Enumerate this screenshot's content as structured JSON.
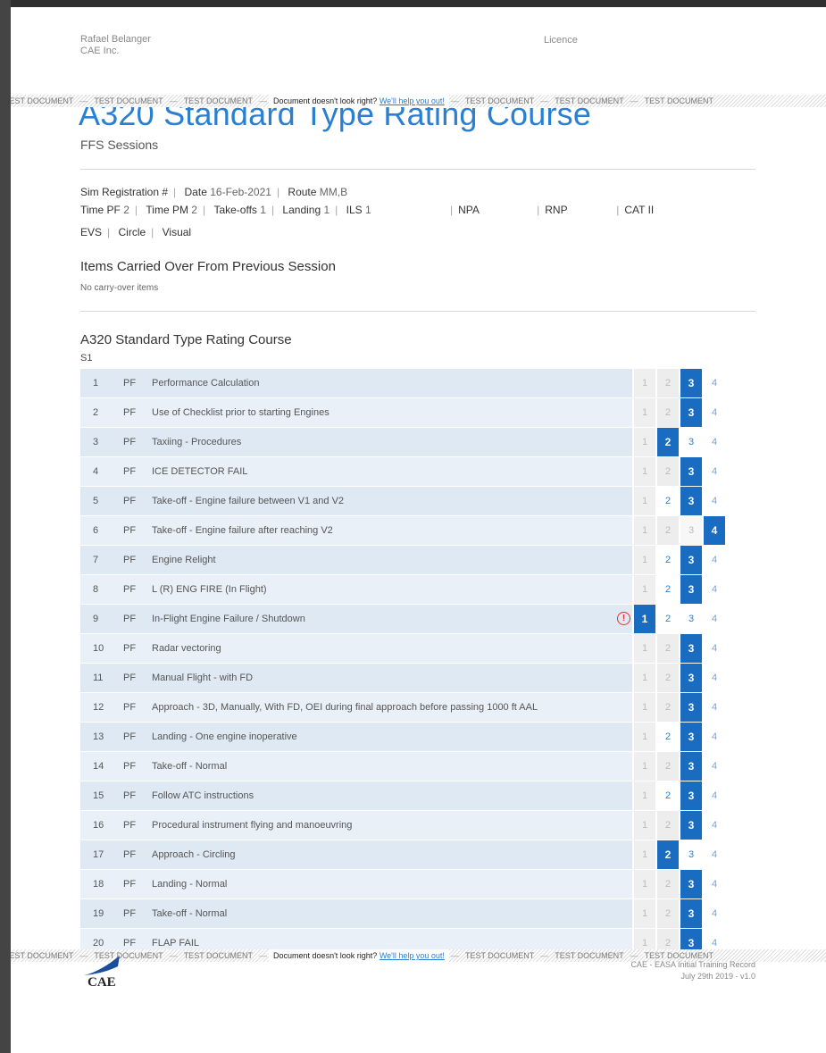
{
  "header": {
    "name": "Rafael Belanger",
    "company": "CAE Inc.",
    "licence_label": "Licence"
  },
  "banner": {
    "tag": "TEST DOCUMENT",
    "message": "Document doesn't look right?",
    "link": "We'll help you out!"
  },
  "title": "A320 Standard Type Rating Course",
  "subtitle": "FFS Sessions",
  "info": {
    "sim_registration_label": "Sim Registration #",
    "date_label": "Date",
    "date_value": "16-Feb-2021",
    "route_label": "Route",
    "route_value": "MM,B",
    "time_pf_label": "Time PF",
    "time_pf_value": "2",
    "time_pm_label": "Time PM",
    "time_pm_value": "2",
    "takeoffs_label": "Take-offs",
    "takeoffs_value": "1",
    "landing_label": "Landing",
    "landing_value": "1",
    "ils_label": "ILS",
    "ils_value": "1",
    "npa_label": "NPA",
    "rnp_label": "RNP",
    "cat2_label": "CAT II",
    "evs_label": "EVS",
    "circle_label": "Circle",
    "visual_label": "Visual"
  },
  "carry_over": {
    "heading": "Items Carried Over From Previous Session",
    "text": "No carry-over items"
  },
  "course": {
    "heading": "A320 Standard Type Rating Course",
    "session": "S1"
  },
  "grade_labels": [
    "1",
    "2",
    "3",
    "4"
  ],
  "items": [
    {
      "num": "1",
      "role": "PF",
      "desc": "Performance Calculation",
      "grade": 3,
      "lit": []
    },
    {
      "num": "2",
      "role": "PF",
      "desc": "Use of Checklist prior to starting Engines",
      "grade": 3,
      "lit": []
    },
    {
      "num": "3",
      "role": "PF",
      "desc": "Taxiing - Procedures",
      "grade": 2,
      "lit": []
    },
    {
      "num": "4",
      "role": "PF",
      "desc": "ICE DETECTOR FAIL",
      "grade": 3,
      "lit": []
    },
    {
      "num": "5",
      "role": "PF",
      "desc": "Take-off - Engine failure between V1 and V2",
      "grade": 3,
      "lit": [
        2
      ]
    },
    {
      "num": "6",
      "role": "PF",
      "desc": "Take-off - Engine failure after reaching V2",
      "grade": 4,
      "lit": []
    },
    {
      "num": "7",
      "role": "PF",
      "desc": "Engine Relight",
      "grade": 3,
      "lit": [
        2
      ]
    },
    {
      "num": "8",
      "role": "PF",
      "desc": "L (R) ENG FIRE (In Flight)",
      "grade": 3,
      "lit": [
        2
      ]
    },
    {
      "num": "9",
      "role": "PF",
      "desc": "In-Flight Engine Failure / Shutdown",
      "grade": 1,
      "lit": [
        2
      ],
      "warning": true
    },
    {
      "num": "10",
      "role": "PF",
      "desc": "Radar vectoring",
      "grade": 3,
      "lit": []
    },
    {
      "num": "11",
      "role": "PF",
      "desc": "Manual Flight - with FD",
      "grade": 3,
      "lit": []
    },
    {
      "num": "12",
      "role": "PF",
      "desc": "Approach - 3D, Manually, With FD, OEI during final approach before passing 1000 ft AAL",
      "grade": 3,
      "lit": []
    },
    {
      "num": "13",
      "role": "PF",
      "desc": "Landing - One engine inoperative",
      "grade": 3,
      "lit": [
        2
      ]
    },
    {
      "num": "14",
      "role": "PF",
      "desc": "Take-off - Normal",
      "grade": 3,
      "lit": []
    },
    {
      "num": "15",
      "role": "PF",
      "desc": "Follow ATC instructions",
      "grade": 3,
      "lit": [
        2
      ]
    },
    {
      "num": "16",
      "role": "PF",
      "desc": "Procedural instrument flying and manoeuvring",
      "grade": 3,
      "lit": []
    },
    {
      "num": "17",
      "role": "PF",
      "desc": "Approach - Circling",
      "grade": 2,
      "lit": []
    },
    {
      "num": "18",
      "role": "PF",
      "desc": "Landing - Normal",
      "grade": 3,
      "lit": []
    },
    {
      "num": "19",
      "role": "PF",
      "desc": "Take-off - Normal",
      "grade": 3,
      "lit": []
    },
    {
      "num": "20",
      "role": "PF",
      "desc": "FLAP FAIL",
      "grade": 3,
      "lit": []
    }
  ],
  "footer": {
    "logo_text": "CAE",
    "line1": "CAE - EASA Initial Training Record",
    "line2": "July 29th 2019 - v1.0"
  }
}
